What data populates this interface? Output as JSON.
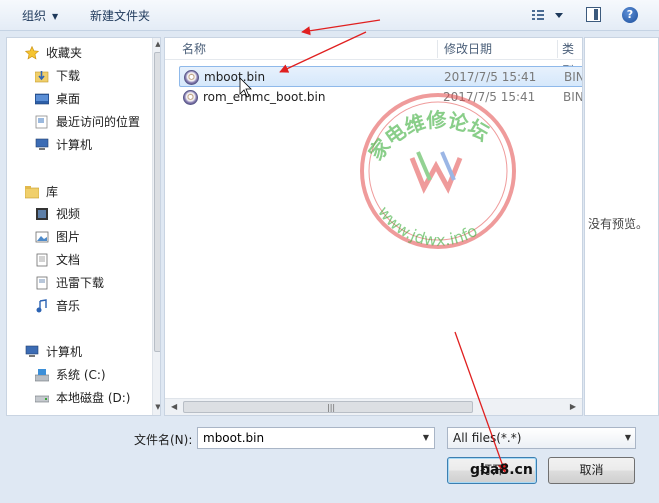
{
  "toolbar": {
    "organize_label": "组织",
    "new_folder_label": "新建文件夹"
  },
  "nav": {
    "favorites": [
      {
        "label": "收藏夹",
        "icon": "star-icon"
      },
      {
        "label": "下载",
        "icon": "download-folder-icon"
      },
      {
        "label": "桌面",
        "icon": "desktop-icon"
      },
      {
        "label": "最近访问的位置",
        "icon": "recent-places-icon"
      },
      {
        "label": "计算机",
        "icon": "computer-icon"
      }
    ],
    "libraries": [
      {
        "label": "库",
        "icon": "library-icon"
      },
      {
        "label": "视频",
        "icon": "video-icon"
      },
      {
        "label": "图片",
        "icon": "pictures-icon"
      },
      {
        "label": "文档",
        "icon": "documents-icon"
      },
      {
        "label": "迅雷下载",
        "icon": "xunlei-download-icon"
      },
      {
        "label": "音乐",
        "icon": "music-icon"
      }
    ],
    "computer": [
      {
        "label": "计算机",
        "icon": "computer-icon"
      },
      {
        "label": "系统 (C:)",
        "icon": "system-drive-icon"
      },
      {
        "label": "本地磁盘 (D:)",
        "icon": "local-disk-icon"
      }
    ]
  },
  "filelist": {
    "headers": {
      "name": "名称",
      "date": "修改日期",
      "type": "类型"
    },
    "files": [
      {
        "name": "mboot.bin",
        "date": "2017/7/5 15:41",
        "type": "BIN",
        "selected": true
      },
      {
        "name": "rom_emmc_boot.bin",
        "date": "2017/7/5 15:41",
        "type": "BIN",
        "selected": false
      }
    ]
  },
  "preview": {
    "empty_text": "没有预览。"
  },
  "bottom": {
    "filename_label": "文件名(N):",
    "filename_value": "mboot.bin",
    "filetype_value": "All files(*.*)",
    "open_label": "打开",
    "cancel_label": "取消"
  },
  "watermark": {
    "circle_text": "家电维修论坛",
    "url_text": "www.jdwx.info",
    "site_text": "gba8.cn"
  },
  "colors": {
    "accent": "#3c7fb1",
    "selection": "#d6e8fb",
    "annotation_arrow": "#e02020",
    "watermark_red": "#e24a4a",
    "watermark_green": "#3cae3c"
  }
}
